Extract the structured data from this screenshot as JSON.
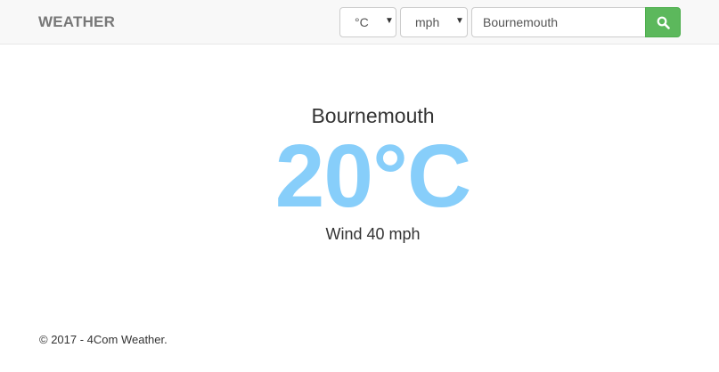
{
  "navbar": {
    "brand": "WEATHER",
    "temp_unit": "°C",
    "speed_unit": "mph",
    "search_value": "Bournemouth",
    "search_button_icon": "search-icon",
    "search_button_color": "#5cb85c"
  },
  "main": {
    "city": "Bournemouth",
    "temperature": "20°C",
    "temperature_color": "#87cefa",
    "wind": "Wind 40 mph"
  },
  "footer": {
    "text": "© 2017 - 4Com Weather."
  }
}
